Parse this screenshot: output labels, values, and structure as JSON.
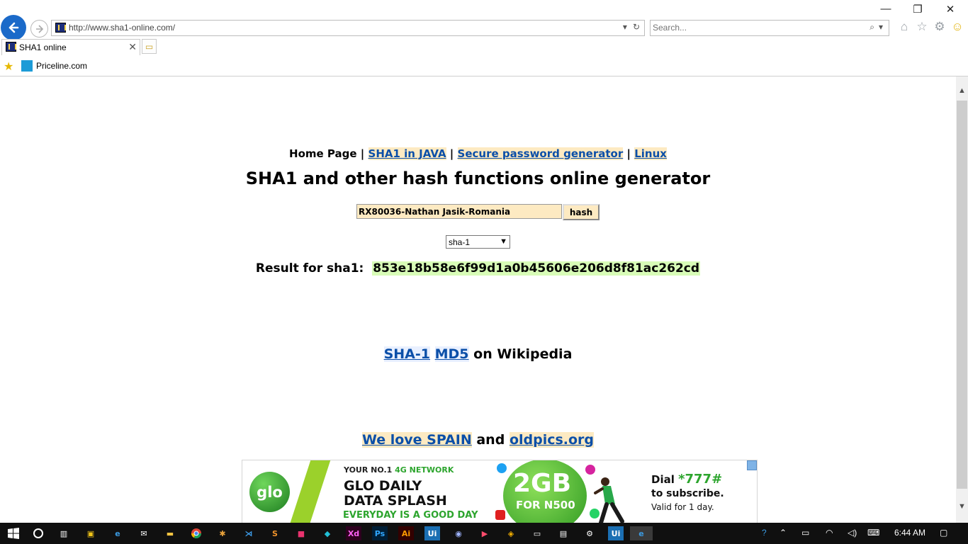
{
  "browser": {
    "url": "http://www.sha1-online.com/",
    "search_placeholder": "Search...",
    "tab_title": "SHA1 online",
    "favorites": [
      {
        "label": "Priceline.com"
      }
    ],
    "window_controls": {
      "minimize": "—",
      "restore": "❐",
      "close": "✕"
    }
  },
  "page": {
    "nav": {
      "home": "Home Page",
      "sep": "|",
      "links": [
        "SHA1 in JAVA",
        "Secure password generator",
        "Linux"
      ]
    },
    "title": "SHA1 and other hash functions online generator",
    "input_value": "RX80036-Nathan Jasik-Romania",
    "hash_button": "hash",
    "algorithm_selected": "sha-1",
    "result_label": "Result for sha1:",
    "result_hash": "853e18b58e6f99d1a0b45606e206d8f81ac262cd",
    "wiki": {
      "link1": "SHA-1",
      "link2": "MD5",
      "suffix": "on Wikipedia"
    },
    "spain": {
      "link1": "We love SPAIN",
      "and": "and",
      "link2": "oldpics.org"
    }
  },
  "ad": {
    "logo": "glo",
    "tagline_prefix": "YOUR NO.1 ",
    "tagline_highlight": "4G NETWORK",
    "headline_1": "GLO DAILY",
    "headline_2": "DATA SPLASH",
    "everyday": "EVERYDAY IS A GOOD DAY",
    "gb": "2GB",
    "for_price": "FOR N500",
    "dial_prefix": "Dial ",
    "dial_code": "*777#",
    "subscribe": "to subscribe.",
    "valid": "Valid for 1 day."
  },
  "taskbar": {
    "time": "6:44 AM",
    "apps": [
      "Xd",
      "Ps",
      "Ai",
      "Ui",
      "Ui"
    ]
  },
  "colors": {
    "link": "#0b4fa8",
    "link_bg": "#fdeac2",
    "hash_bg": "#d8fcb7",
    "back_button": "#1b6ac9"
  }
}
